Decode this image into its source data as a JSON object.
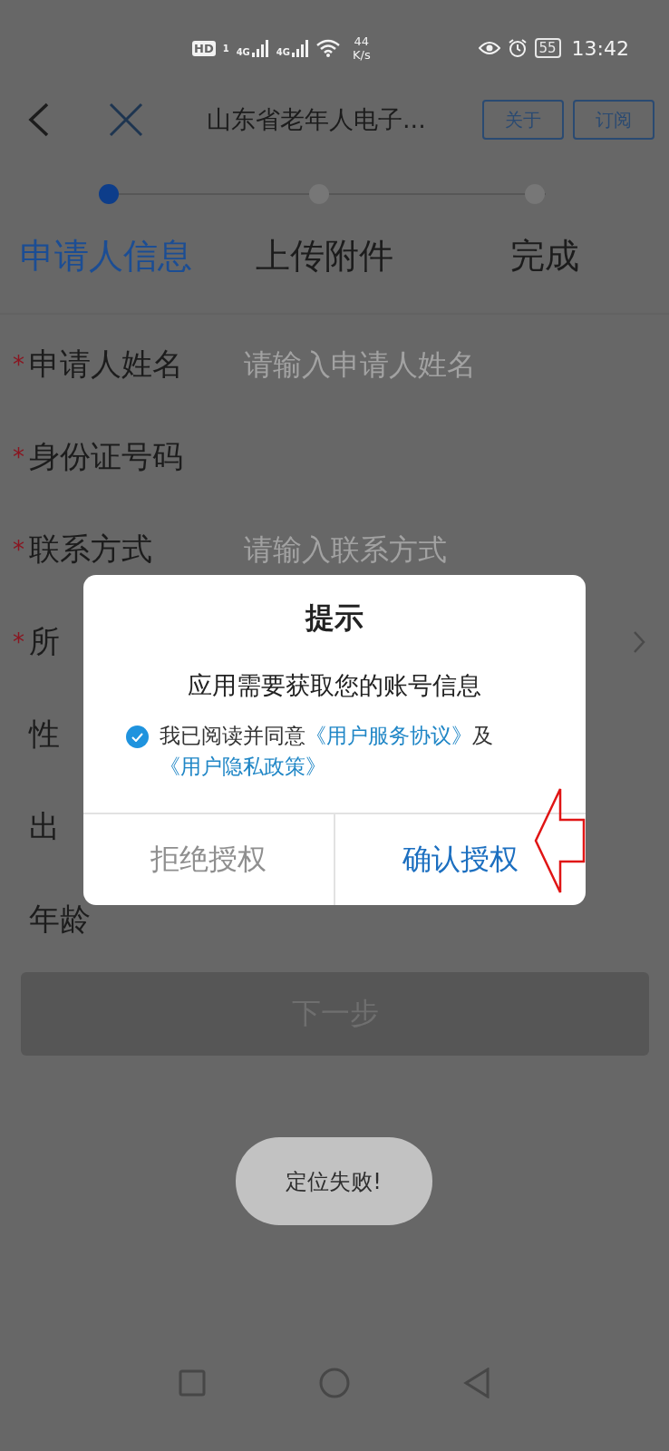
{
  "status_bar": {
    "hd": "HD",
    "sim": "1",
    "networks": [
      "4G",
      "4G"
    ],
    "speed": [
      "44",
      "K/s"
    ],
    "battery": "55",
    "time": "13:42"
  },
  "header": {
    "title": "山东省老年人电子...",
    "buttons": [
      "关于",
      "订阅"
    ]
  },
  "steps": [
    {
      "label": "申请人信息",
      "selected": true
    },
    {
      "label": "上传附件",
      "selected": false
    },
    {
      "label": "完成",
      "selected": false
    }
  ],
  "form": {
    "fields": [
      {
        "mark": "*",
        "label": "申请人姓名",
        "placeholder": "请输入申请人姓名"
      },
      {
        "mark": "*",
        "label": "身份证号码"
      },
      {
        "mark": "*",
        "label": "联系方式",
        "placeholder": "请输入联系方式"
      },
      {
        "mark": "*",
        "label": "所",
        "kind": "select"
      },
      {
        "label": "性"
      },
      {
        "label": "出"
      },
      {
        "label": "年龄"
      }
    ]
  },
  "next_button": {
    "label": "下一步",
    "disabled": true
  },
  "toast": "定位失败!",
  "dialog": {
    "title": "提示",
    "message": "应用需要获取您的账号信息",
    "agreement": {
      "checked": true,
      "text": "我已阅读并同意",
      "link1": "《用户服务协议》",
      "joiner": "及",
      "link2": "《用户隐私政策》"
    },
    "buttons": [
      {
        "label": "拒绝授权",
        "kind": "cancel"
      },
      {
        "label": "确认授权",
        "kind": "confirm"
      }
    ]
  }
}
